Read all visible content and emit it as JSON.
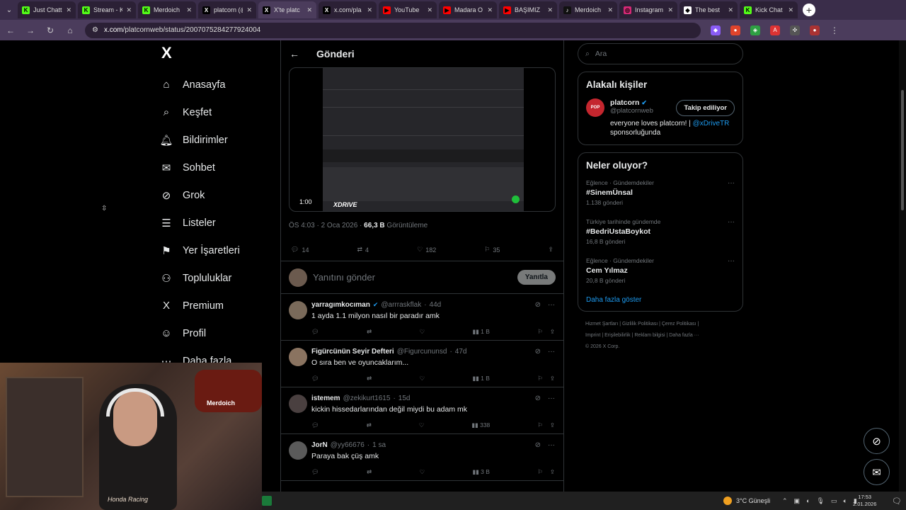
{
  "browser": {
    "tabs": [
      {
        "label": "Just Chatt",
        "icon_color": "#53fc18",
        "icon": "K",
        "active": false
      },
      {
        "label": "Stream - K",
        "icon_color": "#53fc18",
        "icon": "K",
        "active": false
      },
      {
        "label": "Merdoich",
        "icon_color": "#53fc18",
        "icon": "K",
        "active": false
      },
      {
        "label": "platcorn (@",
        "icon_color": "#000000",
        "icon": "X",
        "active": false
      },
      {
        "label": "X'te platc",
        "icon_color": "#000000",
        "icon": "X",
        "active": true
      },
      {
        "label": "x.com/pla",
        "icon_color": "#000000",
        "icon": "X",
        "active": false
      },
      {
        "label": "YouTube",
        "icon_color": "#ff0000",
        "icon": "▶",
        "active": false
      },
      {
        "label": "Madara O",
        "icon_color": "#ff0000",
        "icon": "▶",
        "active": false
      },
      {
        "label": "BAŞIMIZ",
        "icon_color": "#ff0000",
        "icon": "▶",
        "active": false
      },
      {
        "label": "Merdoich",
        "icon_color": "#111111",
        "icon": "♪",
        "active": false
      },
      {
        "label": "Instagram",
        "icon_color": "#d62976",
        "icon": "◎",
        "active": false
      },
      {
        "label": "The best",
        "icon_color": "#ffffff",
        "icon": "◆",
        "active": false
      },
      {
        "label": "Kick Chat",
        "icon_color": "#53fc18",
        "icon": "K",
        "active": false
      }
    ],
    "url_host": "x.com",
    "url_path": "/platcornweb/status/2007075284277924004"
  },
  "nav": {
    "logo": "X",
    "items": [
      {
        "label": "Anasayfa",
        "icon": "⌂",
        "name": "home"
      },
      {
        "label": "Keşfet",
        "icon": "⌕",
        "name": "explore"
      },
      {
        "label": "Bildirimler",
        "icon": "🔔︎",
        "name": "notifications"
      },
      {
        "label": "Sohbet",
        "icon": "✉",
        "name": "chat"
      },
      {
        "label": "Grok",
        "icon": "⊘",
        "name": "grok"
      },
      {
        "label": "Listeler",
        "icon": "☰",
        "name": "lists"
      },
      {
        "label": "Yer İşaretleri",
        "icon": "⚑",
        "name": "bookmarks"
      },
      {
        "label": "Topluluklar",
        "icon": "⚇",
        "name": "communities"
      },
      {
        "label": "Premium",
        "icon": "X",
        "name": "premium"
      },
      {
        "label": "Profil",
        "icon": "☺",
        "name": "profile"
      },
      {
        "label": "Daha fazla",
        "icon": "⋯",
        "name": "more"
      }
    ]
  },
  "post": {
    "header_title": "Gönderi",
    "video_time": "1:00",
    "video_brand": "XDRIVE",
    "time": "ÖS 4:03 · 2 Oca 2026 · ",
    "views": "66,3 B",
    "views_label": " Görüntüleme",
    "replies": "14",
    "reposts": "4",
    "likes": "182",
    "bookmarks": "35"
  },
  "reply_box": {
    "placeholder": "Yanıtını gönder",
    "button": "Yanıtla"
  },
  "replies": [
    {
      "name": "yarragımkocıman",
      "verified": true,
      "handle": "@arrraskflak",
      "time": "44d",
      "text": "1 ayda 1.1 milyon nasıl bir paradır amk",
      "views": "1 B",
      "avatar_color": "#7a6a5a"
    },
    {
      "name": "Figürcünün Seyir Defteri",
      "verified": false,
      "handle": "@Figurcununsd",
      "time": "47d",
      "text": "O sıra ben ve oyuncaklarım...",
      "views": "1 B",
      "avatar_color": "#8a7360"
    },
    {
      "name": "istemem",
      "verified": false,
      "handle": "@zekikurt1615",
      "time": "15d",
      "text": "kickin hissedarlarından değil miydi bu adam mk",
      "views": "338",
      "avatar_color": "#4a4040"
    },
    {
      "name": "JorN",
      "verified": false,
      "handle": "@yy66676",
      "time": "1 sa",
      "text": "Paraya bak çüş amk",
      "views": "3 B",
      "avatar_color": "#5a5a5a"
    }
  ],
  "sidebar": {
    "search_placeholder": "Ara",
    "related_title": "Alakalı kişiler",
    "person": {
      "name": "platcorn",
      "handle": "@platcornweb",
      "follow_label": "Takip ediliyor",
      "bio_prefix": "everyone loves platcorn! | ",
      "bio_link": "@xDriveTR",
      "bio_suffix": "sponsorluğunda"
    },
    "trends_title": "Neler oluyor?",
    "trends": [
      {
        "category": "Eğlence · Gündemdekiler",
        "name": "#SinemÜnsal",
        "count": "1.138 gönderi"
      },
      {
        "category": "Türkiye tarihinde gündemde",
        "name": "#BedriUstaBoykot",
        "count": "16,8 B gönderi"
      },
      {
        "category": "Eğlence · Gündemdekiler",
        "name": "Cem Yılmaz",
        "count": "20,8 B gönderi"
      }
    ],
    "show_more": "Daha fazla göster",
    "footer_line1": "Hizmet Şartları  |  Gizlilik Politikası  |  Çerez Politikası  |",
    "footer_line2": "Imprint  |  Erişilebilirlik  |  Reklam bilgisi  |  Daha fazla ···",
    "footer_line3": "© 2026 X Corp."
  },
  "webcam": {
    "chair_logo": "Merdoich",
    "shirt_logo": "Honda Racing"
  },
  "taskbar": {
    "weather": "3°C  Güneşli",
    "time": "17:53",
    "date": "2.01.2026"
  }
}
